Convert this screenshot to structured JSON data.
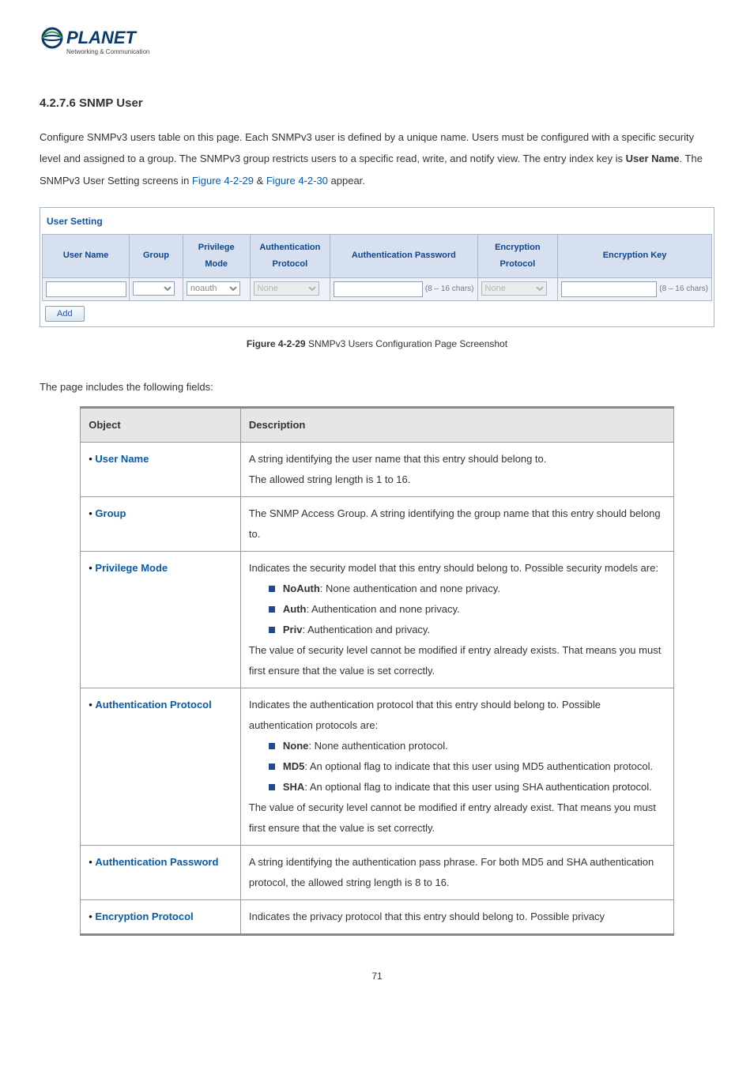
{
  "logo": {
    "brand": "PLANET",
    "tagline": "Networking & Communication"
  },
  "heading": "4.2.7.6 SNMP User",
  "intro": {
    "part1": "Configure SNMPv3 users table on this page. Each SNMPv3 user is defined by a unique name. Users must be configured with a specific security level and assigned to a group. The SNMPv3 group restricts users to a specific read, write, and notify view. The entry index key is ",
    "bold1": "User Name",
    "part2": ". The SNMPv3 User Setting screens in ",
    "link1": "Figure 4-2-29",
    "amp": " & ",
    "link2": "Figure 4-2-30",
    "part3": " appear."
  },
  "user_setting": {
    "legend": "User Setting",
    "headers": [
      "User Name",
      "Group",
      "Privilege Mode",
      "Authentication Protocol",
      "Authentication Password",
      "Encryption Protocol",
      "Encryption Key"
    ],
    "row": {
      "group_selected": "",
      "priv_mode": "noauth",
      "auth_proto": "None",
      "auth_pw_hint": "(8 – 16 chars)",
      "enc_proto": "None",
      "enc_key_hint": "(8 – 16 chars)"
    },
    "add_button": "Add"
  },
  "figure_caption": {
    "label": "Figure 4-2-29",
    "text": " SNMPv3 Users Configuration Page Screenshot"
  },
  "fields_intro": "The page includes the following fields:",
  "fields_table": {
    "headers": [
      "Object",
      "Description"
    ],
    "rows": [
      {
        "object": "User Name",
        "desc_lines": [
          "A string identifying the user name that this entry should belong to.",
          "The allowed string length is 1 to 16."
        ]
      },
      {
        "object": "Group",
        "desc_lines": [
          "The SNMP Access Group. A string identifying the group name that this entry should belong to."
        ]
      },
      {
        "object": "Privilege Mode",
        "desc_custom": "priv_mode"
      },
      {
        "object": "Authentication Protocol",
        "desc_custom": "auth_proto"
      },
      {
        "object": "Authentication Password",
        "desc_lines": [
          "A string identifying the authentication pass phrase. For both MD5 and SHA authentication protocol, the allowed string length is 8 to 16."
        ]
      },
      {
        "object": "Encryption Protocol",
        "desc_lines": [
          "Indicates the privacy protocol that this entry should belong to. Possible privacy"
        ]
      }
    ],
    "priv_mode": {
      "intro": "Indicates the security model that this entry should belong to. Possible security models are:",
      "items": [
        {
          "b": "NoAuth",
          "t": ": None authentication and none privacy."
        },
        {
          "b": "Auth",
          "t": ": Authentication and none privacy."
        },
        {
          "b": "Priv",
          "t": ": Authentication and privacy."
        }
      ],
      "outro": "The value of security level cannot be modified if entry already exists. That means you must first ensure that the value is set correctly."
    },
    "auth_proto": {
      "intro": "Indicates the authentication protocol that this entry should belong to. Possible authentication protocols are:",
      "items": [
        {
          "b": "None",
          "t": ": None authentication protocol."
        },
        {
          "b": "MD5",
          "t": ": An optional flag to indicate that this user using MD5 authentication protocol."
        },
        {
          "b": "SHA",
          "t": ": An optional flag to indicate that this user using SHA authentication protocol."
        }
      ],
      "outro": "The value of security level cannot be modified if entry already exist. That means you must first ensure that the value is set correctly."
    }
  },
  "page_number": "71"
}
